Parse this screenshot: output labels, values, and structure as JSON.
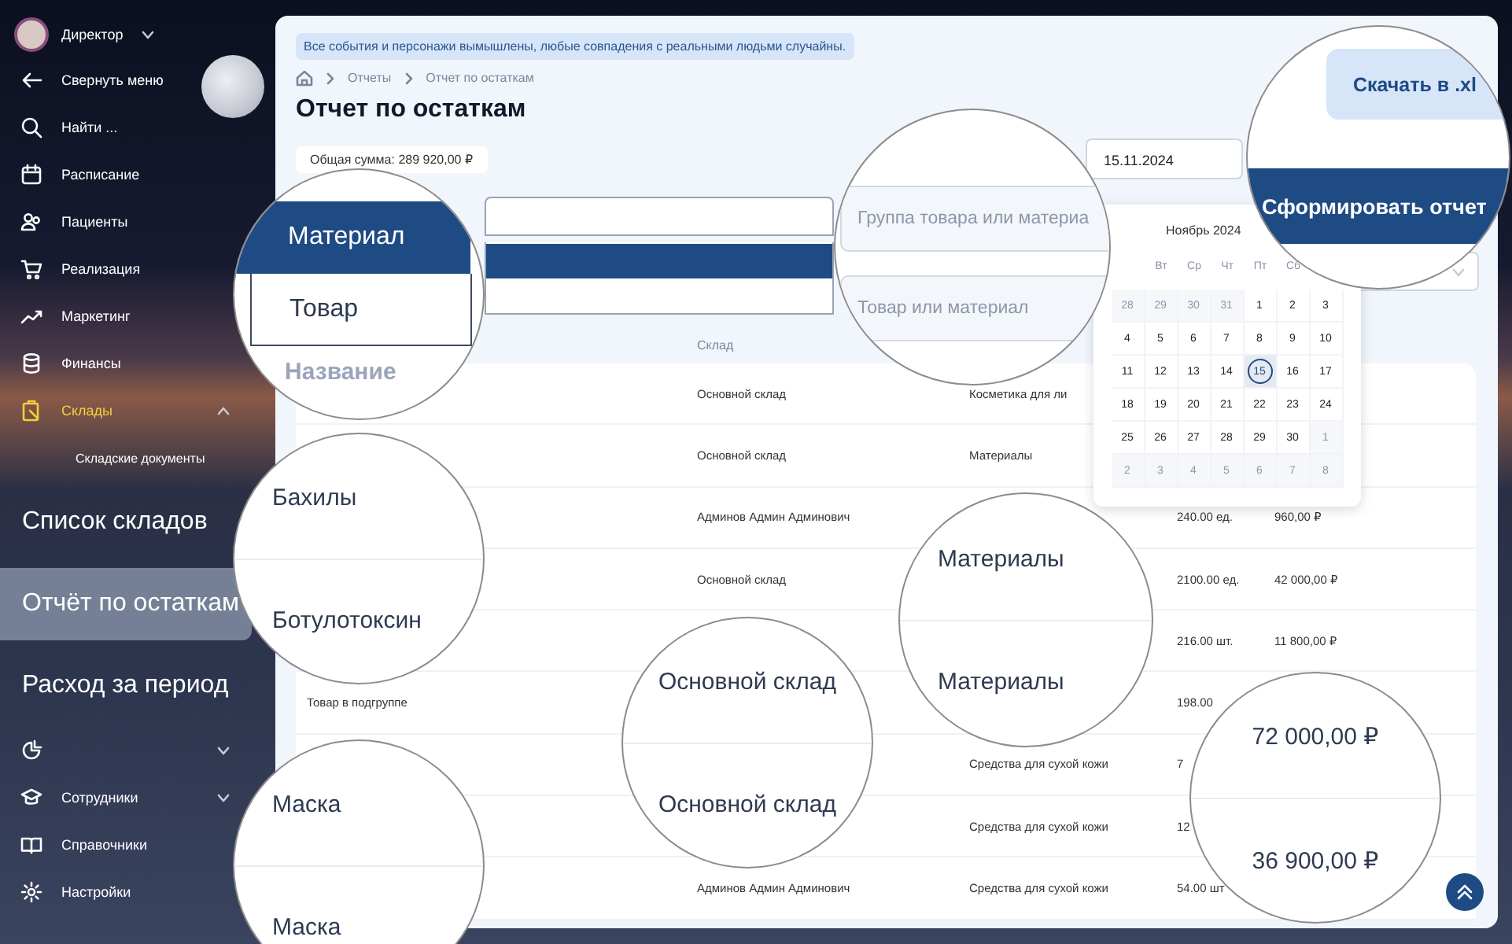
{
  "sidebar": {
    "user": {
      "name": "Директор"
    },
    "items": [
      {
        "label": "Свернуть меню",
        "selected": false
      },
      {
        "label": "Найти ...",
        "selected": false
      },
      {
        "label": "Расписание",
        "selected": false
      },
      {
        "label": "Пациенты",
        "selected": false
      },
      {
        "label": "Реализация",
        "selected": false
      },
      {
        "label": "Маркетинг",
        "selected": false
      },
      {
        "label": "Финансы",
        "selected": false
      },
      {
        "label": "Склады",
        "selected": true,
        "expanded": true,
        "children": [
          {
            "label": "Складские документы",
            "selected": false,
            "magnified": false
          },
          {
            "label": "Список складов",
            "selected": false,
            "magnified": true
          },
          {
            "label": "Отчёт по остаткам",
            "selected": true,
            "magnified": true
          },
          {
            "label": "Расход за период",
            "selected": false,
            "magnified": true
          }
        ]
      },
      {
        "selected": false,
        "expanded": false
      },
      {
        "label": "Сотрудники",
        "selected": false,
        "expanded": false
      },
      {
        "label": "Справочники",
        "selected": false
      },
      {
        "label": "Настройки",
        "selected": false
      }
    ]
  },
  "notice": "Все события и персонажи вымышлены, любые совпадения с реальными людьми случайны.",
  "breadcrumbs": [
    "Отчеты",
    "Отчет по остаткам"
  ],
  "title": "Отчет по остаткам",
  "total": "Общая сумма: 289 920,00 ₽",
  "date_field": {
    "value": "15.11.2024"
  },
  "calendar": {
    "month": "Ноябрь 2024",
    "weekdays": [
      "Вт",
      "Ср",
      "Чт",
      "Пт",
      "Сб"
    ],
    "days": [
      {
        "day": "28",
        "outside": true,
        "selected": false
      },
      {
        "day": "29",
        "outside": true,
        "selected": false
      },
      {
        "day": "30",
        "outside": true,
        "selected": false
      },
      {
        "day": "31",
        "outside": true,
        "selected": false
      },
      {
        "day": "1",
        "outside": false,
        "selected": false
      },
      {
        "day": "2",
        "outside": false,
        "selected": false
      },
      {
        "day": "3",
        "outside": false,
        "selected": false
      },
      {
        "day": "4",
        "outside": false,
        "selected": false
      },
      {
        "day": "5",
        "outside": false,
        "selected": false
      },
      {
        "day": "6",
        "outside": false,
        "selected": false
      },
      {
        "day": "7",
        "outside": false,
        "selected": false
      },
      {
        "day": "8",
        "outside": false,
        "selected": false
      },
      {
        "day": "9",
        "outside": false,
        "selected": false
      },
      {
        "day": "10",
        "outside": false,
        "selected": false
      },
      {
        "day": "11",
        "outside": false,
        "selected": false
      },
      {
        "day": "12",
        "outside": false,
        "selected": false
      },
      {
        "day": "13",
        "outside": false,
        "selected": false
      },
      {
        "day": "14",
        "outside": false,
        "selected": false
      },
      {
        "day": "15",
        "outside": false,
        "selected": true
      },
      {
        "day": "16",
        "outside": false,
        "selected": false
      },
      {
        "day": "17",
        "outside": false,
        "selected": false
      },
      {
        "day": "18",
        "outside": false,
        "selected": false
      },
      {
        "day": "19",
        "outside": false,
        "selected": false
      },
      {
        "day": "20",
        "outside": false,
        "selected": false
      },
      {
        "day": "21",
        "outside": false,
        "selected": false
      },
      {
        "day": "22",
        "outside": false,
        "selected": false
      },
      {
        "day": "23",
        "outside": false,
        "selected": false
      },
      {
        "day": "24",
        "outside": false,
        "selected": false
      },
      {
        "day": "25",
        "outside": false,
        "selected": false
      },
      {
        "day": "26",
        "outside": false,
        "selected": false
      },
      {
        "day": "27",
        "outside": false,
        "selected": false
      },
      {
        "day": "28",
        "outside": false,
        "selected": false
      },
      {
        "day": "29",
        "outside": false,
        "selected": false
      },
      {
        "day": "30",
        "outside": false,
        "selected": false
      },
      {
        "day": "1",
        "outside": true,
        "selected": false
      },
      {
        "day": "2",
        "outside": true,
        "selected": false
      },
      {
        "day": "3",
        "outside": true,
        "selected": false
      },
      {
        "day": "4",
        "outside": true,
        "selected": false
      },
      {
        "day": "5",
        "outside": true,
        "selected": false
      },
      {
        "day": "6",
        "outside": true,
        "selected": false
      },
      {
        "day": "7",
        "outside": true,
        "selected": false
      },
      {
        "day": "8",
        "outside": true,
        "selected": false
      }
    ]
  },
  "table": {
    "columns": [
      "Склад"
    ],
    "rows": [
      {
        "warehouse": "Основной склад",
        "group": "Косметика для ли"
      },
      {
        "warehouse": "Основной склад",
        "group": "Материалы"
      },
      {
        "warehouse": "Админов Админ Админович",
        "qty": "240.00 ед.",
        "sum": "960,00 ₽"
      },
      {
        "warehouse": "Основной склад",
        "qty": "2100.00 ед.",
        "sum": "42 000,00 ₽"
      },
      {
        "qty": "216.00 шт.",
        "sum": "11 800,00 ₽"
      },
      {
        "name": "Товар в подгруппе",
        "qty": "198.00"
      },
      {
        "group": "Средства для сухой кожи",
        "qty": "7"
      },
      {
        "group": "Средства для сухой кожи",
        "qty": "12"
      },
      {
        "warehouse": "Админов Админ Админович",
        "group": "Средства для сухой кожи",
        "qty": "54.00 шт"
      }
    ]
  },
  "magnifiers": [
    {
      "kind": "dropdown",
      "options": [
        {
          "label": "Материал",
          "selected": true
        },
        {
          "label": "Товар",
          "selected": false
        }
      ],
      "caption": "Название"
    },
    {
      "kind": "fields",
      "fields": [
        {
          "placeholder": "Группа товара или материа"
        },
        {
          "placeholder": "Товар или материал"
        }
      ]
    },
    {
      "kind": "buttons",
      "buttons": [
        {
          "label": "Скачать в .xl",
          "primary": false
        },
        {
          "label": "Сформировать отчет",
          "primary": true
        }
      ]
    },
    {
      "kind": "text",
      "lines": [
        "Бахилы",
        "Ботулотоксин"
      ]
    },
    {
      "kind": "text",
      "lines": [
        "Материалы",
        "Материалы"
      ]
    },
    {
      "kind": "text",
      "lines": [
        "Основной склад",
        "Основной склад"
      ]
    },
    {
      "kind": "text",
      "lines": [
        "72 000,00 ₽",
        "36 900,00 ₽"
      ]
    },
    {
      "kind": "text",
      "lines": [
        "Маска",
        "Маска"
      ]
    }
  ]
}
